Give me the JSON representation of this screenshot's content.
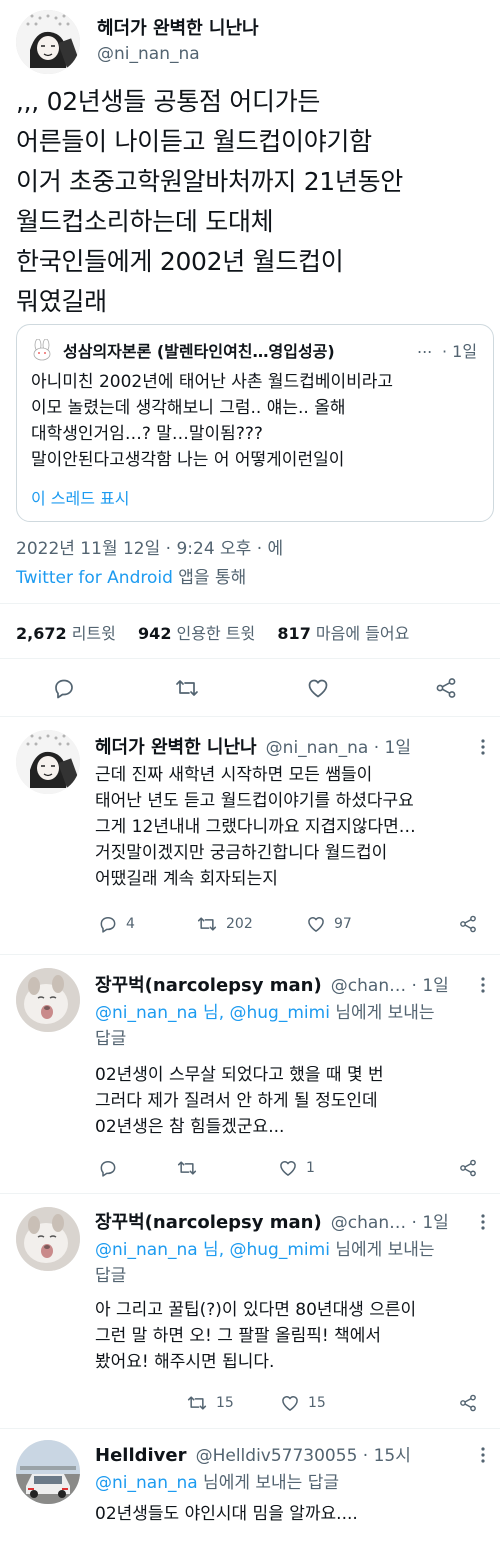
{
  "main_tweet": {
    "display_name": "헤더가 완벽한 니난나",
    "handle": "@ni_nan_na",
    "text_lines": [
      ",,, 02년생들 공통점 어디가든",
      "어른들이 나이듣고 월드컵이야기함",
      "이거 초중고학원알바처까지 21년동안",
      "월드컵소리하는데 도대체",
      "한국인들에게 2002년 월드컵이",
      "뭐였길래"
    ],
    "quote": {
      "author": "성삼의자본론 (발렌타인여친…영입성공)",
      "time": "· 1일",
      "more": "...",
      "lines": [
        "아니미친 2002년에 태어난 사촌 월드컵베이비라고",
        "이모 놀렸는데 생각해보니 그럼.. 얘는.. 올해",
        "대학생인거임…? 말…말이됨???",
        "말이안된다고생각함 나는 어 어떻게이런일이"
      ],
      "show_thread": "이 스레드 표시"
    },
    "timestamp": "2022년 11월 12일 · 9:24 오후 · 에",
    "client": "Twitter for Android",
    "client_suffix": " 앱을 통해",
    "stats": {
      "retweets_count": "2,672",
      "retweets_label": " 리트윗",
      "quotes_count": "942",
      "quotes_label": " 인용한 트윗",
      "likes_count": "817",
      "likes_label": " 마음에 들어요"
    }
  },
  "replies": [
    {
      "display_name": "헤더가 완벽한 니난나",
      "handle": "@ni_nan_na · 1일",
      "replying_to": "",
      "replying_suffix": "",
      "lines": [
        "근데 진짜 새학년 시작하면 모든 쌤들이",
        "태어난 년도 듣고 월드컵이야기를 하셨다구요",
        "그게 12년내내 그랬다니까요 지겹지않다면…",
        "거짓말이겠지만 궁금하긴합니다 월드컵이",
        "어땠길래 계속 회자되는지"
      ],
      "replies_count": "4",
      "retweets_count": "202",
      "likes_count": "97"
    },
    {
      "display_name": "장꾸벅(narcolepsy man)",
      "handle": "@chan… · 1일",
      "replying_to": "@ni_nan_na 님, @hug_mimi",
      "replying_suffix": " 님에게 보내는",
      "replying_suffix2": "답글",
      "lines": [
        "02년생이 스무살 되었다고 했을 때 몇 번",
        "그러다 제가 질려서 안 하게 될 정도인데",
        "02년생은 참 힘들겠군요..."
      ],
      "replies_count": "",
      "retweets_count": "",
      "likes_count": "1"
    },
    {
      "display_name": "장꾸벅(narcolepsy man)",
      "handle": "@chan… · 1일",
      "replying_to": "@ni_nan_na 님, @hug_mimi",
      "replying_suffix": " 님에게 보내는",
      "replying_suffix2": "답글",
      "lines": [
        "아 그리고 꿀팁(?)이 있다면 80년대생 으른이",
        "그런 말 하면  오! 그 팔팔 올림픽! 책에서",
        "봤어요! 해주시면 됩니다."
      ],
      "replies_count": "",
      "retweets_count": "15",
      "likes_count": "15"
    },
    {
      "display_name": "Helldiver",
      "handle": "@Helldiv57730055 · 15시",
      "replying_to": "@ni_nan_na",
      "replying_suffix": " 님에게 보내는 답글",
      "lines": [
        "02년생들도 야인시대 밈을 알까요...."
      ]
    }
  ],
  "icons": [
    "reply-icon",
    "retweet-icon",
    "like-icon",
    "share-icon",
    "more-icon"
  ],
  "colors": {
    "accent": "#1d9bf0",
    "secondary_text": "#536471",
    "divider": "#eff3f4"
  }
}
